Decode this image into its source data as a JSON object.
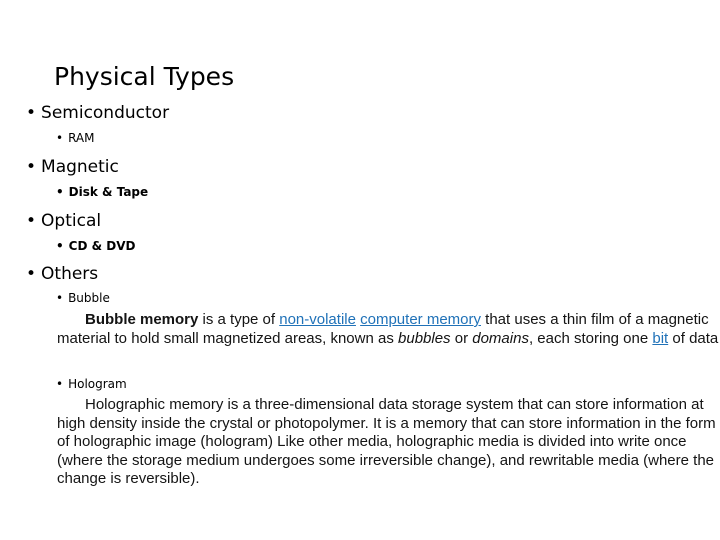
{
  "slide": {
    "title": "Physical Types",
    "background_color": "#FFFFFF",
    "text_color": "#000000",
    "link_color": "#2072B8",
    "outline": [
      {
        "level": 1,
        "text": "Semiconductor"
      },
      {
        "level": 2,
        "text": "RAM"
      },
      {
        "level": 1,
        "text": "Magnetic"
      },
      {
        "level": 2,
        "text": "Disk & Tape"
      },
      {
        "level": 1,
        "text": "Optical"
      },
      {
        "level": 2,
        "text": "CD & DVD"
      },
      {
        "level": 1,
        "text": "Others"
      },
      {
        "level": 2,
        "text": "Bubble"
      },
      {
        "level": 2,
        "text": "Hologram"
      }
    ],
    "bullet_glyph": "•",
    "paragraphs": {
      "bubble": {
        "lead_bold": "Bubble memory",
        "seg_1": " is a type of ",
        "link_1": "non-volatile",
        "seg_2": " ",
        "link_2": "computer memory",
        "seg_3": " that uses a thin film of a magnetic material to hold small magnetized areas, known as ",
        "italic_1": "bubbles",
        "seg_4": " or ",
        "italic_2": "domains",
        "seg_5": ", each storing one ",
        "link_3": "bit",
        "seg_6": " of data"
      },
      "hologram": {
        "text": "Holographic memory is a three-dimensional data storage system that can store information at high density inside the crystal or photopolymer. It is a memory that can store information in the form of holographic image (hologram) Like other media, holographic media is divided into write once (where the storage medium undergoes some irreversible change), and rewritable media (where the change is reversible)."
      }
    }
  }
}
